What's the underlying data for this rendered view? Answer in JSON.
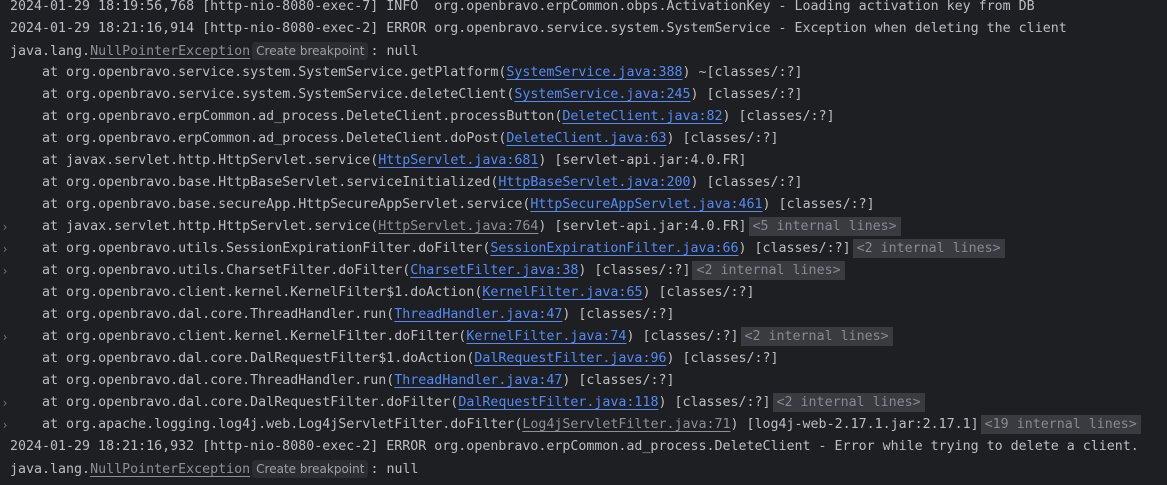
{
  "colors": {
    "background": "#1e1f22",
    "text": "#bcbec4",
    "link": "#548af7",
    "muted_link": "#8c8f96",
    "badge_bg": "#393b40"
  },
  "lines": [
    {
      "fold": false,
      "indent": false,
      "segs": [
        [
          "text",
          "2024-01-29 18:19:56,768 [http-nio-8080-exec-7] INFO  org.openbravo.erpCommon.obps.ActivationKey - Loading activation key from DB"
        ]
      ]
    },
    {
      "fold": false,
      "indent": false,
      "segs": [
        [
          "text",
          "2024-01-29 18:21:16,914 [http-nio-8080-exec-2] ERROR org.openbravo.service.system.SystemService - Exception when deleting the client"
        ]
      ]
    },
    {
      "fold": false,
      "indent": false,
      "segs": [
        [
          "text",
          "java.lang."
        ],
        [
          "muted",
          "NullPointerException"
        ],
        [
          "bp",
          "Create breakpoint"
        ],
        [
          "text",
          ": null"
        ]
      ]
    },
    {
      "fold": false,
      "indent": true,
      "segs": [
        [
          "text",
          "at org.openbravo.service.system.SystemService.getPlatform("
        ],
        [
          "link",
          "SystemService.java:388"
        ],
        [
          "text",
          ") ~[classes/:?]"
        ]
      ]
    },
    {
      "fold": false,
      "indent": true,
      "segs": [
        [
          "text",
          "at org.openbravo.service.system.SystemService.deleteClient("
        ],
        [
          "link",
          "SystemService.java:245"
        ],
        [
          "text",
          ") [classes/:?]"
        ]
      ]
    },
    {
      "fold": false,
      "indent": true,
      "segs": [
        [
          "text",
          "at org.openbravo.erpCommon.ad_process.DeleteClient.processButton("
        ],
        [
          "link",
          "DeleteClient.java:82"
        ],
        [
          "text",
          ") [classes/:?]"
        ]
      ]
    },
    {
      "fold": false,
      "indent": true,
      "segs": [
        [
          "text",
          "at org.openbravo.erpCommon.ad_process.DeleteClient.doPost("
        ],
        [
          "link",
          "DeleteClient.java:63"
        ],
        [
          "text",
          ") [classes/:?]"
        ]
      ]
    },
    {
      "fold": false,
      "indent": true,
      "segs": [
        [
          "text",
          "at javax.servlet.http.HttpServlet.service("
        ],
        [
          "link",
          "HttpServlet.java:681"
        ],
        [
          "text",
          ") [servlet-api.jar:4.0.FR]"
        ]
      ]
    },
    {
      "fold": false,
      "indent": true,
      "segs": [
        [
          "text",
          "at org.openbravo.base.HttpBaseServlet.serviceInitialized("
        ],
        [
          "link",
          "HttpBaseServlet.java:200"
        ],
        [
          "text",
          ") [classes/:?]"
        ]
      ]
    },
    {
      "fold": false,
      "indent": true,
      "segs": [
        [
          "text",
          "at org.openbravo.base.secureApp.HttpSecureAppServlet.service("
        ],
        [
          "link",
          "HttpSecureAppServlet.java:461"
        ],
        [
          "text",
          ") [classes/:?]"
        ]
      ]
    },
    {
      "fold": true,
      "indent": true,
      "segs": [
        [
          "text",
          "at javax.servlet.http.HttpServlet.service("
        ],
        [
          "muted",
          "HttpServlet.java:764"
        ],
        [
          "text",
          ") [servlet-api.jar:4.0.FR]"
        ],
        [
          "badge",
          "<5 internal lines>"
        ]
      ]
    },
    {
      "fold": true,
      "indent": true,
      "segs": [
        [
          "text",
          "at org.openbravo.utils.SessionExpirationFilter.doFilter("
        ],
        [
          "link",
          "SessionExpirationFilter.java:66"
        ],
        [
          "text",
          ") [classes/:?]"
        ],
        [
          "badge",
          "<2 internal lines>"
        ]
      ]
    },
    {
      "fold": true,
      "indent": true,
      "segs": [
        [
          "text",
          "at org.openbravo.utils.CharsetFilter.doFilter("
        ],
        [
          "link",
          "CharsetFilter.java:38"
        ],
        [
          "text",
          ") [classes/:?]"
        ],
        [
          "badge",
          "<2 internal lines>"
        ]
      ]
    },
    {
      "fold": false,
      "indent": true,
      "segs": [
        [
          "text",
          "at org.openbravo.client.kernel.KernelFilter$1.doAction("
        ],
        [
          "link",
          "KernelFilter.java:65"
        ],
        [
          "text",
          ") [classes/:?]"
        ]
      ]
    },
    {
      "fold": false,
      "indent": true,
      "segs": [
        [
          "text",
          "at org.openbravo.dal.core.ThreadHandler.run("
        ],
        [
          "link",
          "ThreadHandler.java:47"
        ],
        [
          "text",
          ") [classes/:?]"
        ]
      ]
    },
    {
      "fold": true,
      "indent": true,
      "segs": [
        [
          "text",
          "at org.openbravo.client.kernel.KernelFilter.doFilter("
        ],
        [
          "link",
          "KernelFilter.java:74"
        ],
        [
          "text",
          ") [classes/:?]"
        ],
        [
          "badge",
          "<2 internal lines>"
        ]
      ]
    },
    {
      "fold": false,
      "indent": true,
      "segs": [
        [
          "text",
          "at org.openbravo.dal.core.DalRequestFilter$1.doAction("
        ],
        [
          "link",
          "DalRequestFilter.java:96"
        ],
        [
          "text",
          ") [classes/:?]"
        ]
      ]
    },
    {
      "fold": false,
      "indent": true,
      "segs": [
        [
          "text",
          "at org.openbravo.dal.core.ThreadHandler.run("
        ],
        [
          "link",
          "ThreadHandler.java:47"
        ],
        [
          "text",
          ") [classes/:?]"
        ]
      ]
    },
    {
      "fold": true,
      "indent": true,
      "segs": [
        [
          "text",
          "at org.openbravo.dal.core.DalRequestFilter.doFilter("
        ],
        [
          "link",
          "DalRequestFilter.java:118"
        ],
        [
          "text",
          ") [classes/:?]"
        ],
        [
          "badge",
          "<2 internal lines>"
        ]
      ]
    },
    {
      "fold": true,
      "indent": true,
      "segs": [
        [
          "text",
          "at org.apache.logging.log4j.web.Log4jServletFilter.doFilter("
        ],
        [
          "muted",
          "Log4jServletFilter.java:71"
        ],
        [
          "text",
          ") [log4j-web-2.17.1.jar:2.17.1]"
        ],
        [
          "badge",
          "<19 internal lines>"
        ]
      ]
    },
    {
      "fold": false,
      "indent": false,
      "segs": [
        [
          "text",
          "2024-01-29 18:21:16,932 [http-nio-8080-exec-2] ERROR org.openbravo.erpCommon.ad_process.DeleteClient - Error while trying to delete a client."
        ]
      ]
    },
    {
      "fold": false,
      "indent": false,
      "segs": [
        [
          "text",
          "java.lang."
        ],
        [
          "muted",
          "NullPointerException"
        ],
        [
          "bp",
          "Create breakpoint"
        ],
        [
          "text",
          ": null"
        ]
      ]
    }
  ]
}
